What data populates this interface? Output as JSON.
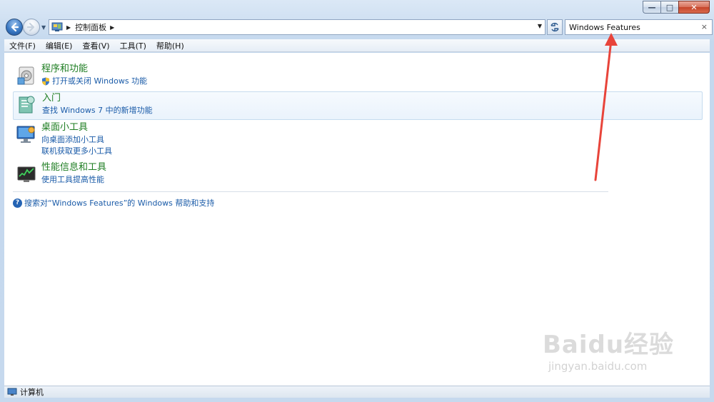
{
  "window": {
    "buttons": {
      "minimize": "—",
      "maximize": "□",
      "close": "✕"
    }
  },
  "address_bar": {
    "breadcrumb": "控制面板",
    "icon": "control-panel-icon"
  },
  "search": {
    "value": "Windows Features",
    "clear": "×"
  },
  "menu": [
    "文件(F)",
    "编辑(E)",
    "查看(V)",
    "工具(T)",
    "帮助(H)"
  ],
  "results": [
    {
      "title": "程序和功能",
      "links": [
        "打开或关闭 Windows 功能"
      ],
      "icon": "programs-features-icon",
      "shield": true
    },
    {
      "title": "入门",
      "links": [
        "查找 Windows 7 中的新增功能"
      ],
      "icon": "getting-started-icon",
      "shield": false
    },
    {
      "title": "桌面小工具",
      "links": [
        "向桌面添加小工具",
        "联机获取更多小工具"
      ],
      "icon": "desktop-gadgets-icon",
      "shield": false
    },
    {
      "title": "性能信息和工具",
      "links": [
        "使用工具提高性能"
      ],
      "icon": "performance-icon",
      "shield": false
    }
  ],
  "help_link": "搜索对“Windows Features”的 Windows 帮助和支持",
  "status": "计算机",
  "watermark": {
    "brand": "Baidu经验",
    "sub": "jingyan.baidu.com"
  },
  "colors": {
    "title_green": "#1e7d22",
    "link_blue": "#1a5ba8",
    "annotation_red": "#e8443a"
  }
}
